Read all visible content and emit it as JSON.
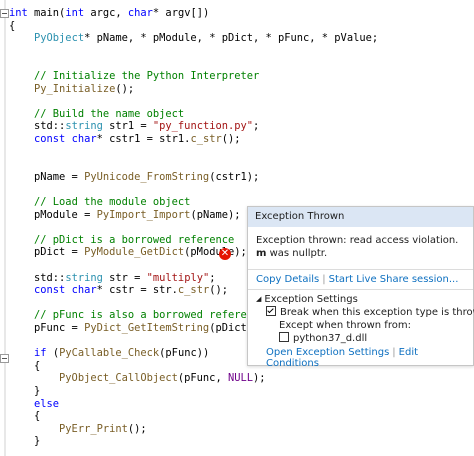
{
  "code": {
    "lines": [
      [
        {
          "t": "int ",
          "c": "kw"
        },
        {
          "t": "main("
        },
        {
          "t": "int ",
          "c": "kw"
        },
        {
          "t": "argc, "
        },
        {
          "t": "char",
          "c": "kw"
        },
        {
          "t": "* argv[])"
        }
      ],
      [
        {
          "t": "{"
        }
      ],
      [
        {
          "t": "    "
        },
        {
          "t": "PyObject",
          "c": "ty"
        },
        {
          "t": "* pName, * pModule, * pDict, * pFunc, * pValue;"
        }
      ],
      [
        {
          "t": ""
        }
      ],
      [
        {
          "t": ""
        }
      ],
      [
        {
          "t": "    "
        },
        {
          "t": "// Initialize the Python Interpreter",
          "c": "cm"
        }
      ],
      [
        {
          "t": "    "
        },
        {
          "t": "Py_Initialize",
          "c": "fn"
        },
        {
          "t": "();"
        }
      ],
      [
        {
          "t": ""
        }
      ],
      [
        {
          "t": "    "
        },
        {
          "t": "// Build the name object",
          "c": "cm"
        }
      ],
      [
        {
          "t": "    std::"
        },
        {
          "t": "string ",
          "c": "ty"
        },
        {
          "t": "str1 = "
        },
        {
          "t": "\"py_function.py\"",
          "c": "st"
        },
        {
          "t": ";"
        }
      ],
      [
        {
          "t": "    "
        },
        {
          "t": "const char",
          "c": "kw"
        },
        {
          "t": "* cstr1 = str1."
        },
        {
          "t": "c_str",
          "c": "fn"
        },
        {
          "t": "();"
        }
      ],
      [
        {
          "t": ""
        }
      ],
      [
        {
          "t": ""
        }
      ],
      [
        {
          "t": "    pName = "
        },
        {
          "t": "PyUnicode_FromString",
          "c": "fn"
        },
        {
          "t": "(cstr1);"
        }
      ],
      [
        {
          "t": ""
        }
      ],
      [
        {
          "t": "    "
        },
        {
          "t": "// Load the module object",
          "c": "cm"
        }
      ],
      [
        {
          "t": "    pModule = "
        },
        {
          "t": "PyImport_Import",
          "c": "fn"
        },
        {
          "t": "(pName);"
        }
      ],
      [
        {
          "t": ""
        }
      ],
      [
        {
          "t": "    "
        },
        {
          "t": "// pDict is a borrowed reference",
          "c": "cm"
        }
      ],
      [
        {
          "t": "    pDict = "
        },
        {
          "t": "PyModule_GetDict",
          "c": "fn"
        },
        {
          "t": "(pModule);"
        }
      ],
      [
        {
          "t": ""
        }
      ],
      [
        {
          "t": "    std::"
        },
        {
          "t": "string ",
          "c": "ty"
        },
        {
          "t": "str = "
        },
        {
          "t": "\"multiply\"",
          "c": "st"
        },
        {
          "t": ";"
        }
      ],
      [
        {
          "t": "    "
        },
        {
          "t": "const char",
          "c": "kw"
        },
        {
          "t": "* cstr = str."
        },
        {
          "t": "c_str",
          "c": "fn"
        },
        {
          "t": "();"
        }
      ],
      [
        {
          "t": ""
        }
      ],
      [
        {
          "t": "    "
        },
        {
          "t": "// pFunc is also a borrowed reference",
          "c": "cm"
        }
      ],
      [
        {
          "t": "    pFunc = "
        },
        {
          "t": "PyDict_GetItemString",
          "c": "fn"
        },
        {
          "t": "(pDict, cstr)"
        }
      ],
      [
        {
          "t": ""
        }
      ],
      [
        {
          "t": "    "
        },
        {
          "t": "if ",
          "c": "kw"
        },
        {
          "t": "("
        },
        {
          "t": "PyCallable_Check",
          "c": "fn"
        },
        {
          "t": "(pFunc))"
        }
      ],
      [
        {
          "t": "    {"
        }
      ],
      [
        {
          "t": "        "
        },
        {
          "t": "PyObject_CallObject",
          "c": "fn"
        },
        {
          "t": "(pFunc, "
        },
        {
          "t": "NULL",
          "c": "nm"
        },
        {
          "t": ");"
        }
      ],
      [
        {
          "t": "    }"
        }
      ],
      [
        {
          "t": "    "
        },
        {
          "t": "else",
          "c": "kw"
        }
      ],
      [
        {
          "t": "    {"
        }
      ],
      [
        {
          "t": "        "
        },
        {
          "t": "PyErr_Print",
          "c": "fn"
        },
        {
          "t": "();"
        }
      ],
      [
        {
          "t": "    }"
        }
      ]
    ]
  },
  "error_icon": {
    "glyph": "✕",
    "icon": "error-circle-icon"
  },
  "popup": {
    "title": "Exception Thrown",
    "message_line1": "Exception thrown: read access violation.",
    "message_var": "m",
    "message_line2_rest": " was nullptr.",
    "copy_details": "Copy Details",
    "divider": "|",
    "live_share": "Start Live Share session...",
    "settings_header": "Exception Settings",
    "break_label": "Break when this exception type is thrown",
    "break_checked": true,
    "except_label": "Except when thrown from:",
    "module_name": "python37_d.dll",
    "module_checked": false,
    "open_settings": "Open Exception Settings",
    "edit_conditions": "Edit Conditions",
    "header_color": "#dbe6f4",
    "link_color": "#0e70c0"
  }
}
